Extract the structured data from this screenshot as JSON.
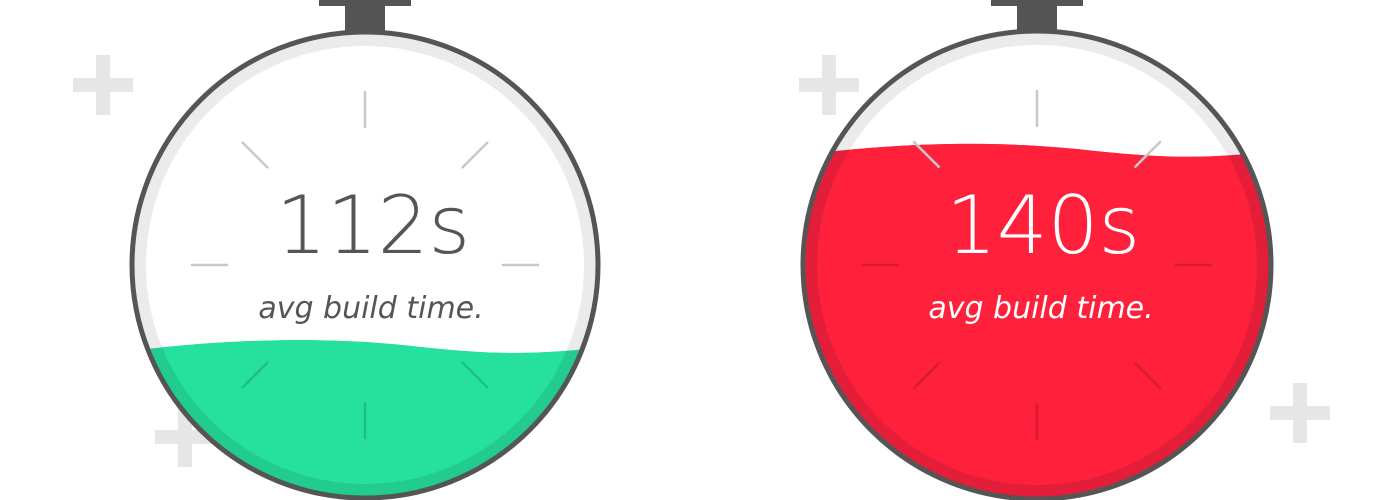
{
  "gauges": [
    {
      "value": "112s",
      "label": "avg build time.",
      "fill_level": 0.33,
      "fill_color": "#26e09d",
      "rim_color": "#22cc8f",
      "text_color": "#555555",
      "on_fill_text_color": "#555555"
    },
    {
      "value": "140s",
      "label": "avg build time.",
      "fill_level": 0.75,
      "fill_color": "#ff203b",
      "rim_color": "#e41e38",
      "text_color": "#ffffff",
      "on_fill_text_color": "#ffffff"
    }
  ],
  "colors": {
    "outline": "#555555",
    "inner_ring": "#ebebeb",
    "tick": "#c8c8c8",
    "plus": "#e6e6e6",
    "background": "#ffffff"
  },
  "decorations": {
    "icon": "plus-icon"
  }
}
